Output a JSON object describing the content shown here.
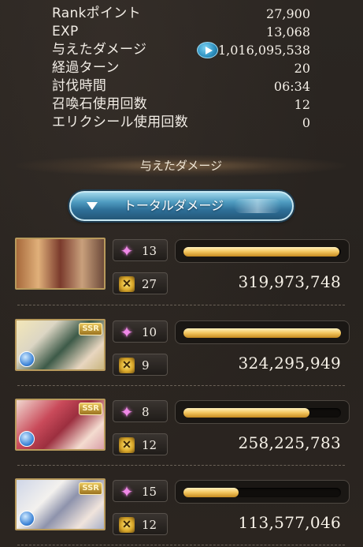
{
  "stats": [
    {
      "label": "Rankポイント",
      "value": "27,900"
    },
    {
      "label": "EXP",
      "value": "13,068"
    },
    {
      "label": "与えたダメージ",
      "value": "1,016,095,538",
      "icon": "play-icon"
    },
    {
      "label": "経過ターン",
      "value": "20"
    },
    {
      "label": "討伐時間",
      "value": "06:34"
    },
    {
      "label": "召喚石使用回数",
      "value": "12"
    },
    {
      "label": "エリクシール使用回数",
      "value": "0"
    }
  ],
  "section_title": "与えたダメージ",
  "dropdown": {
    "label": "トータルダメージ",
    "icon": "triangle-down-icon"
  },
  "badge_label": "SSR",
  "characters": [
    {
      "skills": "13",
      "ca": "27",
      "damage": "319,973,748",
      "bar_fill": 0.99,
      "ssr": false
    },
    {
      "skills": "10",
      "ca": "9",
      "damage": "324,295,949",
      "bar_fill": 1.0,
      "ssr": true
    },
    {
      "skills": "8",
      "ca": "12",
      "damage": "258,225,783",
      "bar_fill": 0.8,
      "ssr": true
    },
    {
      "skills": "15",
      "ca": "12",
      "damage": "113,577,046",
      "bar_fill": 0.35,
      "ssr": true
    }
  ],
  "colors": {
    "accent": "#2e6f98",
    "bar": "#f2c45c",
    "skill": "#f089e8"
  }
}
